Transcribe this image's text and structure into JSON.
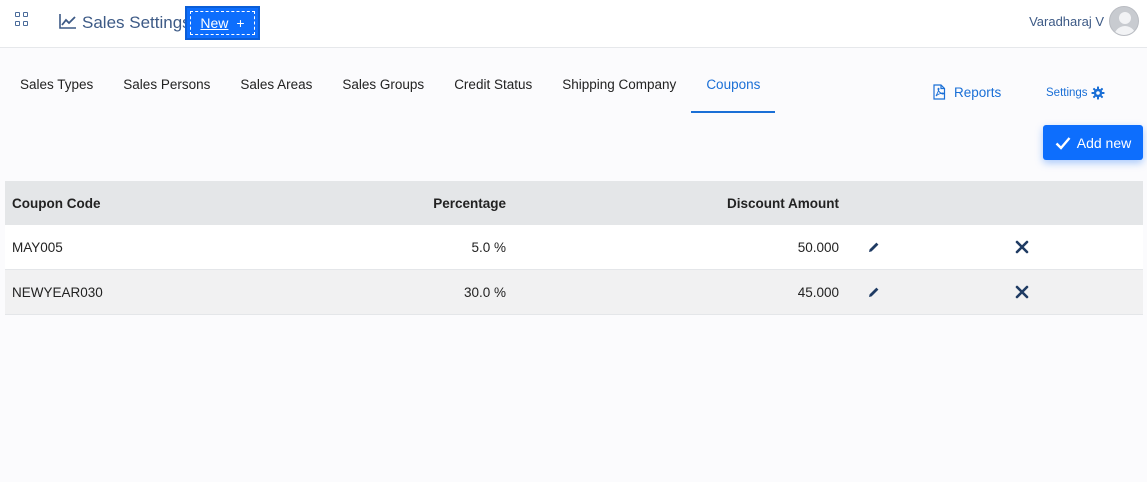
{
  "header": {
    "title": "Sales Settings",
    "new_button": {
      "label": "New",
      "icon": "+"
    },
    "user_name": "Varadharaj V"
  },
  "tabs": [
    {
      "label": "Sales Types"
    },
    {
      "label": "Sales Persons"
    },
    {
      "label": "Sales Areas"
    },
    {
      "label": "Sales Groups"
    },
    {
      "label": "Credit Status"
    },
    {
      "label": "Shipping Company"
    },
    {
      "label": "Coupons",
      "active": true
    }
  ],
  "actions": {
    "reports_label": "Reports",
    "settings_label": "Settings",
    "add_new_label": "Add new"
  },
  "table": {
    "columns": [
      "Coupon Code",
      "Percentage",
      "Discount Amount"
    ],
    "rows": [
      {
        "code": "MAY005",
        "percentage": "5.0 %",
        "amount": "50.000"
      },
      {
        "code": "NEWYEAR030",
        "percentage": "30.0 %",
        "amount": "45.000"
      }
    ]
  },
  "colors": {
    "accent": "#0d6efd",
    "link": "#1a6fd6",
    "title": "#3d5a86",
    "icon_dark": "#1f3b63"
  }
}
